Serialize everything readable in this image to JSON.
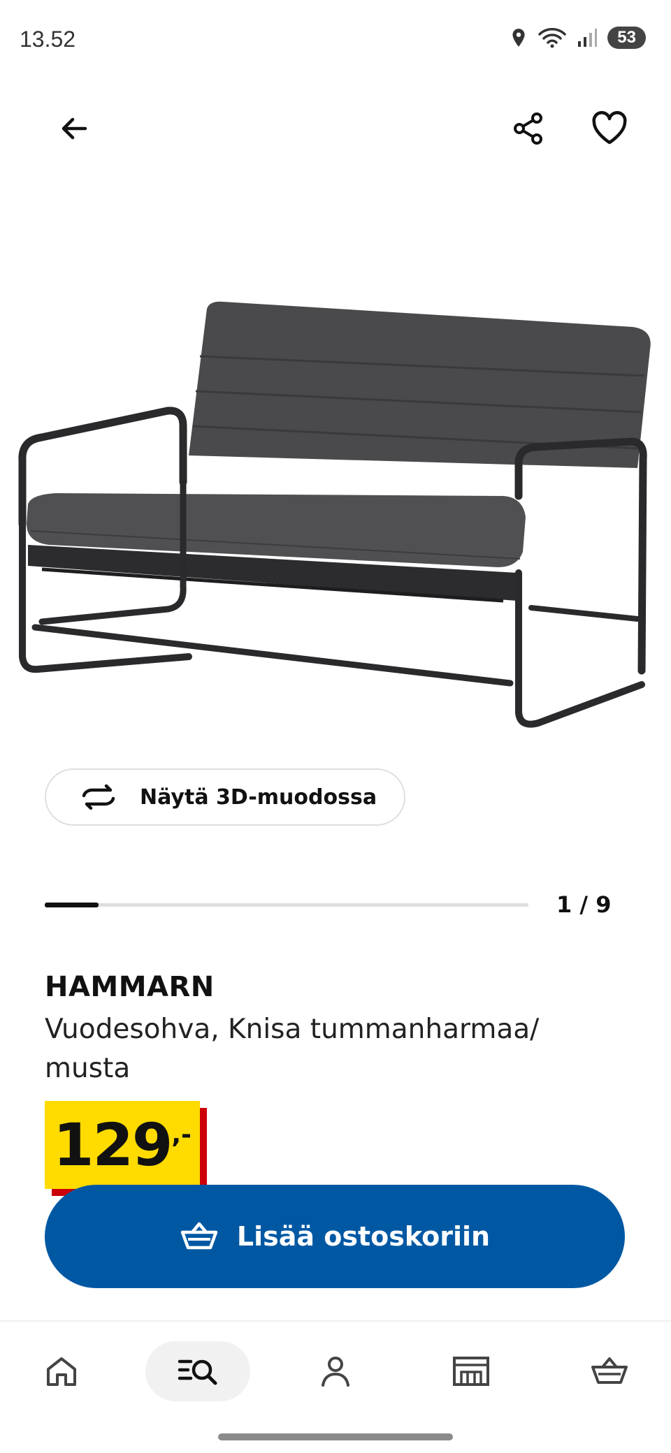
{
  "status_bar": {
    "time": "13.52",
    "battery": "53"
  },
  "top_bar": {
    "back": "arrow-left-icon",
    "share": "share-icon",
    "favorite": "heart-icon"
  },
  "product": {
    "brand": "HAMMARN",
    "description": "Vuodesohva, Knisa tummanharmaa/ musta",
    "price_integer": "129",
    "price_decimal": ",-",
    "image_label": "sofa bed image"
  },
  "view_3d": {
    "label": "Näytä 3D-muodossa"
  },
  "pager": {
    "current": 1,
    "total": 9,
    "label": "1 / 9"
  },
  "add_to_cart": {
    "label": "Lisää ostoskoriin"
  },
  "bottom_nav": [
    {
      "id": "home",
      "icon": "home-icon",
      "active": false
    },
    {
      "id": "search",
      "icon": "search-list-icon",
      "active": true
    },
    {
      "id": "profile",
      "icon": "person-icon",
      "active": false
    },
    {
      "id": "store",
      "icon": "store-icon",
      "active": false
    },
    {
      "id": "cart",
      "icon": "basket-icon",
      "active": false
    }
  ],
  "colors": {
    "accent": "#0058a3",
    "price_bg": "#ffdb00",
    "price_shadow": "#cc0008"
  }
}
